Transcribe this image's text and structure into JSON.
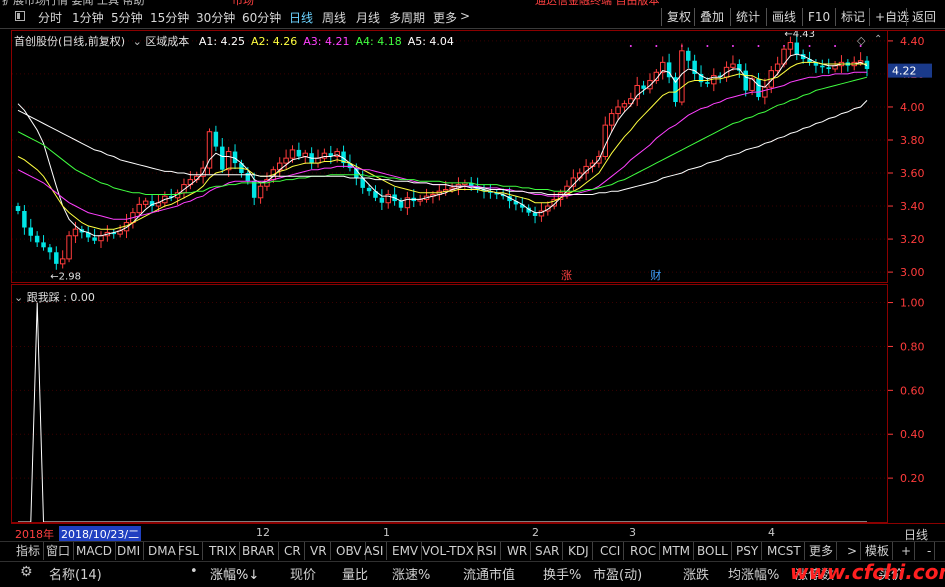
{
  "toolbar": {
    "periods": [
      "分时",
      "1分钟",
      "5分钟",
      "15分钟",
      "30分钟",
      "60分钟",
      "日线",
      "周线",
      "月线",
      "多周期",
      "更多"
    ],
    "active_period": "日线",
    "more_arrow": ">",
    "right_buttons": [
      "复权",
      "叠加",
      "统计",
      "画线",
      "F10",
      "标记",
      "+自选",
      "返回"
    ]
  },
  "main": {
    "stock_title": "首创股份(日线,前复权)",
    "indicator_name": "区域成本",
    "legend": [
      {
        "label": "A1:",
        "value": "4.25",
        "color": "#ffffff"
      },
      {
        "label": "A2:",
        "value": "4.26",
        "color": "#ffff40"
      },
      {
        "label": "A3:",
        "value": "4.21",
        "color": "#ff40ff"
      },
      {
        "label": "A4:",
        "value": "4.18",
        "color": "#40ff40"
      },
      {
        "label": "A5:",
        "value": "4.04",
        "color": "#ffffff"
      }
    ],
    "current_price": "4.22",
    "high_mark": "4.43",
    "low_mark": "2.98",
    "event_badges": [
      "涨",
      "财"
    ],
    "colors": {
      "up": "#ff3c3c",
      "down": "#00e5e5",
      "a1": "#ffffff",
      "a2": "#ffff40",
      "a3": "#ff40ff",
      "a4": "#40ff40",
      "a5": "#ffffff",
      "grid": "#8b0000",
      "axis": "#ff3c3c"
    }
  },
  "sub": {
    "indicator_name": "跟我踩",
    "value": ": 0.00"
  },
  "chart_data": {
    "type": "candlestick",
    "yaxis_main": {
      "ticks": [
        4.4,
        4.2,
        4.0,
        3.8,
        3.6,
        3.4,
        3.2,
        3.0
      ],
      "ylim": [
        2.94,
        4.46
      ]
    },
    "yaxis_sub": {
      "ticks": [
        1.0,
        0.8,
        0.6,
        0.4,
        0.2
      ],
      "ylim": [
        0,
        1.08
      ]
    },
    "time_labels": [
      "2018年",
      "2018/10/23/二",
      "12",
      "1",
      "2",
      "3",
      "4"
    ],
    "close": [
      3.37,
      3.27,
      3.22,
      3.18,
      3.15,
      3.12,
      3.05,
      3.08,
      3.22,
      3.26,
      3.24,
      3.21,
      3.19,
      3.22,
      3.24,
      3.23,
      3.25,
      3.3,
      3.36,
      3.41,
      3.43,
      3.4,
      3.42,
      3.46,
      3.45,
      3.48,
      3.53,
      3.56,
      3.58,
      3.63,
      3.85,
      3.76,
      3.62,
      3.73,
      3.66,
      3.6,
      3.55,
      3.45,
      3.52,
      3.56,
      3.62,
      3.66,
      3.69,
      3.74,
      3.7,
      3.72,
      3.66,
      3.69,
      3.72,
      3.7,
      3.73,
      3.66,
      3.63,
      3.57,
      3.51,
      3.49,
      3.45,
      3.42,
      3.47,
      3.43,
      3.39,
      3.45,
      3.43,
      3.44,
      3.46,
      3.47,
      3.49,
      3.5,
      3.51,
      3.53,
      3.54,
      3.52,
      3.5,
      3.49,
      3.48,
      3.47,
      3.46,
      3.43,
      3.41,
      3.39,
      3.36,
      3.34,
      3.37,
      3.4,
      3.44,
      3.48,
      3.52,
      3.57,
      3.6,
      3.64,
      3.66,
      3.7,
      3.89,
      3.96,
      4.0,
      4.02,
      4.05,
      4.13,
      4.11,
      4.16,
      4.21,
      4.27,
      4.18,
      4.03,
      4.34,
      4.28,
      4.2,
      4.15,
      4.14,
      4.19,
      4.18,
      4.24,
      4.26,
      4.22,
      4.1,
      4.17,
      4.06,
      4.12,
      4.22,
      4.26,
      4.35,
      4.39,
      4.32,
      4.29,
      4.27,
      4.25,
      4.24,
      4.23,
      4.25,
      4.27,
      4.25,
      4.27,
      4.28,
      4.23
    ],
    "series": [
      {
        "name": "A1",
        "values": [
          4.02,
          3.98,
          3.92,
          3.86,
          3.78,
          3.65,
          3.52,
          3.4,
          3.32,
          3.28,
          3.25,
          3.24,
          3.22,
          3.22,
          3.23,
          3.24,
          3.25,
          3.27,
          3.3,
          3.34,
          3.38,
          3.41,
          3.42,
          3.44,
          3.45,
          3.47,
          3.5,
          3.53,
          3.56,
          3.6,
          3.68,
          3.72,
          3.7,
          3.7,
          3.69,
          3.66,
          3.62,
          3.56,
          3.54,
          3.55,
          3.58,
          3.62,
          3.65,
          3.68,
          3.69,
          3.7,
          3.69,
          3.69,
          3.7,
          3.7,
          3.71,
          3.69,
          3.66,
          3.62,
          3.57,
          3.53,
          3.49,
          3.46,
          3.46,
          3.45,
          3.43,
          3.44,
          3.44,
          3.44,
          3.45,
          3.46,
          3.47,
          3.48,
          3.5,
          3.51,
          3.52,
          3.52,
          3.51,
          3.5,
          3.49,
          3.48,
          3.47,
          3.45,
          3.43,
          3.41,
          3.38,
          3.36,
          3.36,
          3.38,
          3.41,
          3.45,
          3.49,
          3.53,
          3.57,
          3.61,
          3.64,
          3.68,
          3.77,
          3.85,
          3.92,
          3.97,
          4.01,
          4.07,
          4.1,
          4.13,
          4.17,
          4.22,
          4.21,
          4.15,
          4.2,
          4.23,
          4.22,
          4.19,
          4.17,
          4.18,
          4.18,
          4.21,
          4.23,
          4.23,
          4.18,
          4.17,
          4.13,
          4.12,
          4.16,
          4.2,
          4.26,
          4.31,
          4.32,
          4.31,
          4.29,
          4.27,
          4.26,
          4.25,
          4.25,
          4.26,
          4.26,
          4.26,
          4.27,
          4.25
        ]
      },
      {
        "name": "A2",
        "values": [
          3.7,
          3.68,
          3.65,
          3.62,
          3.58,
          3.52,
          3.46,
          3.4,
          3.36,
          3.33,
          3.3,
          3.28,
          3.27,
          3.26,
          3.26,
          3.26,
          3.27,
          3.28,
          3.3,
          3.32,
          3.34,
          3.36,
          3.38,
          3.4,
          3.41,
          3.43,
          3.45,
          3.47,
          3.49,
          3.52,
          3.57,
          3.6,
          3.61,
          3.63,
          3.63,
          3.63,
          3.62,
          3.59,
          3.58,
          3.58,
          3.59,
          3.61,
          3.62,
          3.64,
          3.65,
          3.66,
          3.66,
          3.66,
          3.67,
          3.67,
          3.68,
          3.67,
          3.66,
          3.64,
          3.62,
          3.6,
          3.58,
          3.56,
          3.54,
          3.52,
          3.51,
          3.5,
          3.49,
          3.48,
          3.48,
          3.48,
          3.48,
          3.49,
          3.49,
          3.5,
          3.5,
          3.5,
          3.5,
          3.49,
          3.49,
          3.48,
          3.48,
          3.47,
          3.46,
          3.45,
          3.44,
          3.42,
          3.42,
          3.42,
          3.43,
          3.45,
          3.47,
          3.49,
          3.51,
          3.54,
          3.57,
          3.6,
          3.66,
          3.72,
          3.77,
          3.82,
          3.86,
          3.91,
          3.95,
          3.99,
          4.03,
          4.07,
          4.09,
          4.09,
          4.12,
          4.15,
          4.16,
          4.16,
          4.16,
          4.17,
          4.17,
          4.18,
          4.19,
          4.2,
          4.19,
          4.19,
          4.17,
          4.16,
          4.17,
          4.18,
          4.21,
          4.24,
          4.26,
          4.27,
          4.27,
          4.27,
          4.26,
          4.26,
          4.26,
          4.26,
          4.26,
          4.26,
          4.26,
          4.26
        ]
      },
      {
        "name": "A3",
        "values": [
          3.62,
          3.6,
          3.58,
          3.56,
          3.54,
          3.51,
          3.48,
          3.45,
          3.42,
          3.4,
          3.38,
          3.36,
          3.35,
          3.34,
          3.33,
          3.32,
          3.32,
          3.32,
          3.33,
          3.34,
          3.35,
          3.36,
          3.37,
          3.38,
          3.39,
          3.4,
          3.42,
          3.43,
          3.45,
          3.46,
          3.49,
          3.51,
          3.52,
          3.54,
          3.55,
          3.55,
          3.55,
          3.55,
          3.55,
          3.55,
          3.56,
          3.57,
          3.58,
          3.59,
          3.6,
          3.61,
          3.62,
          3.62,
          3.63,
          3.63,
          3.64,
          3.64,
          3.64,
          3.63,
          3.62,
          3.62,
          3.61,
          3.6,
          3.59,
          3.58,
          3.57,
          3.56,
          3.55,
          3.54,
          3.54,
          3.53,
          3.53,
          3.53,
          3.52,
          3.52,
          3.52,
          3.52,
          3.52,
          3.51,
          3.51,
          3.51,
          3.5,
          3.5,
          3.49,
          3.49,
          3.48,
          3.47,
          3.47,
          3.46,
          3.46,
          3.46,
          3.46,
          3.47,
          3.48,
          3.49,
          3.5,
          3.52,
          3.55,
          3.58,
          3.61,
          3.64,
          3.68,
          3.71,
          3.74,
          3.77,
          3.81,
          3.84,
          3.87,
          3.89,
          3.92,
          3.95,
          3.97,
          3.99,
          4.0,
          4.02,
          4.03,
          4.05,
          4.06,
          4.07,
          4.08,
          4.09,
          4.09,
          4.1,
          4.11,
          4.12,
          4.13,
          4.15,
          4.16,
          4.17,
          4.18,
          4.18,
          4.19,
          4.19,
          4.2,
          4.2,
          4.2,
          4.21,
          4.21,
          4.21
        ]
      },
      {
        "name": "A4",
        "values": [
          3.85,
          3.83,
          3.81,
          3.79,
          3.77,
          3.74,
          3.71,
          3.68,
          3.65,
          3.62,
          3.6,
          3.58,
          3.56,
          3.54,
          3.53,
          3.51,
          3.5,
          3.49,
          3.48,
          3.48,
          3.47,
          3.47,
          3.47,
          3.47,
          3.47,
          3.47,
          3.48,
          3.48,
          3.49,
          3.49,
          3.51,
          3.52,
          3.52,
          3.53,
          3.53,
          3.54,
          3.54,
          3.54,
          3.54,
          3.54,
          3.55,
          3.55,
          3.56,
          3.56,
          3.57,
          3.57,
          3.58,
          3.58,
          3.58,
          3.59,
          3.59,
          3.59,
          3.59,
          3.59,
          3.59,
          3.58,
          3.58,
          3.58,
          3.57,
          3.57,
          3.56,
          3.56,
          3.56,
          3.55,
          3.55,
          3.55,
          3.55,
          3.54,
          3.54,
          3.54,
          3.54,
          3.54,
          3.53,
          3.53,
          3.53,
          3.53,
          3.52,
          3.52,
          3.52,
          3.51,
          3.51,
          3.5,
          3.5,
          3.5,
          3.49,
          3.49,
          3.49,
          3.49,
          3.49,
          3.5,
          3.5,
          3.51,
          3.52,
          3.53,
          3.55,
          3.56,
          3.58,
          3.6,
          3.62,
          3.64,
          3.66,
          3.68,
          3.7,
          3.72,
          3.74,
          3.76,
          3.78,
          3.8,
          3.82,
          3.84,
          3.86,
          3.88,
          3.9,
          3.91,
          3.93,
          3.94,
          3.96,
          3.97,
          3.99,
          4.01,
          4.02,
          4.04,
          4.05,
          4.07,
          4.08,
          4.1,
          4.11,
          4.12,
          4.13,
          4.14,
          4.15,
          4.16,
          4.17,
          4.18
        ]
      },
      {
        "name": "A5",
        "values": [
          3.98,
          3.96,
          3.94,
          3.92,
          3.9,
          3.88,
          3.86,
          3.84,
          3.82,
          3.8,
          3.78,
          3.76,
          3.74,
          3.73,
          3.71,
          3.7,
          3.68,
          3.67,
          3.66,
          3.65,
          3.64,
          3.63,
          3.62,
          3.61,
          3.61,
          3.6,
          3.6,
          3.59,
          3.59,
          3.59,
          3.59,
          3.59,
          3.59,
          3.59,
          3.59,
          3.59,
          3.59,
          3.59,
          3.58,
          3.58,
          3.58,
          3.58,
          3.58,
          3.58,
          3.58,
          3.58,
          3.58,
          3.58,
          3.58,
          3.58,
          3.58,
          3.58,
          3.57,
          3.57,
          3.57,
          3.57,
          3.56,
          3.56,
          3.56,
          3.55,
          3.55,
          3.55,
          3.54,
          3.54,
          3.54,
          3.53,
          3.53,
          3.53,
          3.52,
          3.52,
          3.52,
          3.51,
          3.51,
          3.51,
          3.5,
          3.5,
          3.5,
          3.49,
          3.49,
          3.49,
          3.48,
          3.48,
          3.48,
          3.47,
          3.47,
          3.47,
          3.47,
          3.47,
          3.47,
          3.47,
          3.47,
          3.48,
          3.48,
          3.49,
          3.49,
          3.5,
          3.51,
          3.52,
          3.53,
          3.54,
          3.55,
          3.57,
          3.58,
          3.59,
          3.6,
          3.62,
          3.63,
          3.64,
          3.66,
          3.67,
          3.68,
          3.7,
          3.71,
          3.72,
          3.74,
          3.75,
          3.76,
          3.78,
          3.79,
          3.81,
          3.82,
          3.84,
          3.85,
          3.87,
          3.88,
          3.9,
          3.91,
          3.93,
          3.94,
          3.96,
          3.97,
          3.99,
          4.0,
          4.04
        ]
      }
    ],
    "sub_series": {
      "name": "跟我踩",
      "spike_index": 3,
      "spike_value": 1.0
    }
  },
  "timeaxis": {
    "right_label": "日线"
  },
  "tabs": {
    "left_label": "指标",
    "items": [
      "窗口",
      "MACD",
      "DMI",
      "DMA",
      "FSL",
      "TRIX",
      "BRAR",
      "CR",
      "VR",
      "OBV",
      "ASI",
      "EMV",
      "VOL-TDX",
      "RSI",
      "WR",
      "SAR",
      "KDJ",
      "CCI",
      "ROC",
      "MTM",
      "BOLL",
      "PSY",
      "MCST",
      "更多"
    ],
    "arrow": ">",
    "template": "模板",
    "plus": "+",
    "minus": "-"
  },
  "columns": {
    "items": [
      "名称(14)",
      "•",
      "涨幅%↓",
      "现价",
      "量比",
      "涨速%",
      "流通市值",
      "换手%",
      "市盈(动)",
      "涨跌",
      "均涨幅%",
      "涨停数",
      "买价"
    ]
  },
  "watermark": "www.cfchi.com"
}
